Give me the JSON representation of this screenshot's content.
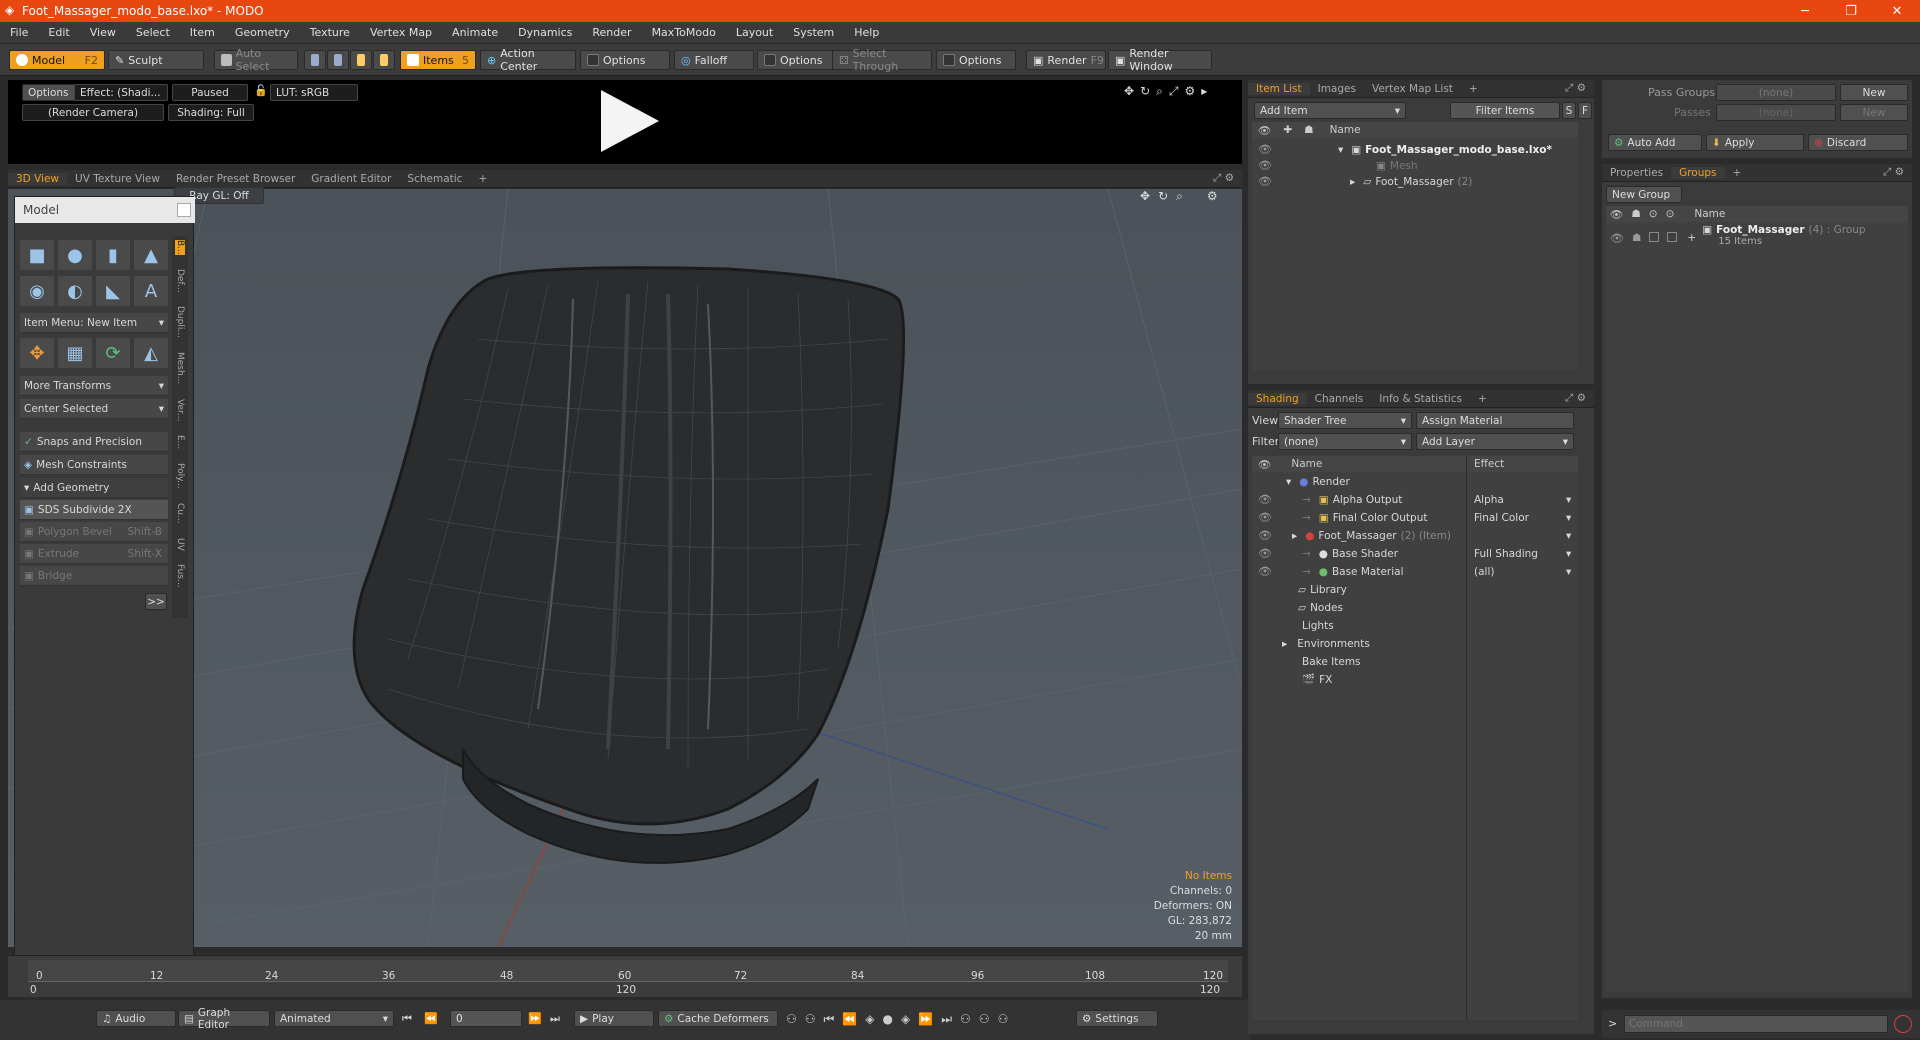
{
  "title": "Foot_Massager_modo_base.lxo* - MODO",
  "menu": [
    "File",
    "Edit",
    "View",
    "Select",
    "Item",
    "Geometry",
    "Texture",
    "Vertex Map",
    "Animate",
    "Dynamics",
    "Render",
    "MaxToModo",
    "Layout",
    "System",
    "Help"
  ],
  "toolbar": {
    "model": "Model",
    "model_key": "F2",
    "sculpt": "Sculpt",
    "auto_select": "Auto Select",
    "items": "Items",
    "items_key": "5",
    "action_center": "Action Center",
    "options1": "Options",
    "falloff": "Falloff",
    "options2": "Options",
    "select_through": "Select Through",
    "options3": "Options",
    "render": "Render",
    "render_key": "F9",
    "render_window": "Render Window"
  },
  "preview": {
    "options": "Options",
    "effect": "Effect: (Shadi...",
    "paused": "Paused",
    "lut": "LUT: sRGB",
    "camera": "(Render Camera)",
    "shading": "Shading: Full"
  },
  "vtabs": [
    "3D View",
    "UV Texture View",
    "Render Preset Browser",
    "Gradient Editor",
    "Schematic"
  ],
  "viewport": {
    "raygl": "Ray GL: Off",
    "stats": [
      "No Items",
      "Channels: 0",
      "Deformers: ON",
      "GL: 283,872",
      "20 mm"
    ]
  },
  "toolbox": {
    "title": "Model",
    "item_menu": "Item Menu: New Item",
    "more_transforms": "More Transforms",
    "center_selected": "Center Selected",
    "snaps": "Snaps and Precision",
    "mesh_constraints": "Mesh Constraints",
    "add_geometry": "Add Geometry",
    "sds": "SDS Subdivide 2X",
    "polygon_bevel": "Polygon Bevel",
    "bevel_key": "Shift-B",
    "extrude": "Extrude",
    "extrude_key": "Shift-X",
    "bridge": "Bridge",
    "more": ">>",
    "side_tabs": [
      "B...",
      "Def...",
      "Dupli...",
      "Mesh...",
      "Ver...",
      "E...",
      "Poly...",
      "Cu...",
      "UV",
      "Fus..."
    ]
  },
  "timeline": {
    "ticks": [
      "0",
      "12",
      "24",
      "36",
      "48",
      "60",
      "72",
      "84",
      "96",
      "108",
      "120"
    ],
    "start": "0",
    "mid": "120",
    "end": "120"
  },
  "bottom": {
    "audio": "Audio",
    "graph_editor": "Graph Editor",
    "animated": "Animated",
    "frame": "0",
    "play": "Play",
    "cache": "Cache Deformers",
    "settings": "Settings"
  },
  "itemlist": {
    "tabs": [
      "Item List",
      "Images",
      "Vertex Map List"
    ],
    "add_item": "Add Item",
    "filter": "Filter Items",
    "s": "S",
    "f": "F",
    "name_col": "Name",
    "root": "Foot_Massager_modo_base.lxo*",
    "mesh": "Mesh",
    "group": "Foot_Massager",
    "group_count": "(2)"
  },
  "shading": {
    "tabs": [
      "Shading",
      "Channels",
      "Info & Statistics"
    ],
    "view_label": "View",
    "view": "Shader Tree",
    "assign": "Assign Material",
    "filter_label": "Filter",
    "filter": "(none)",
    "add_layer": "Add Layer",
    "name_col": "Name",
    "effect_col": "Effect",
    "rows": [
      {
        "name": "Render",
        "effect": ""
      },
      {
        "name": "Alpha Output",
        "effect": "Alpha"
      },
      {
        "name": "Final Color Output",
        "effect": "Final Color"
      },
      {
        "name": "Foot_Massager",
        "suffix": "(2) (Item)",
        "effect": ""
      },
      {
        "name": "Base Shader",
        "effect": "Full Shading"
      },
      {
        "name": "Base Material",
        "effect": "(all)"
      }
    ],
    "extras": [
      "Library",
      "Nodes",
      "Lights",
      "Environments",
      "Bake Items",
      "FX"
    ]
  },
  "passes": {
    "pass_groups": "Pass Groups",
    "passes": "Passes",
    "none": "(none)",
    "new": "New",
    "auto_add": "Auto Add",
    "apply": "Apply",
    "discard": "Discard"
  },
  "groups": {
    "tabs": [
      "Properties",
      "Groups"
    ],
    "new_group": "New Group",
    "name_col": "Name",
    "group_name": "Foot_Massager",
    "group_meta": "(4) : Group",
    "items": "15 Items"
  },
  "command": {
    "placeholder": "Command"
  }
}
